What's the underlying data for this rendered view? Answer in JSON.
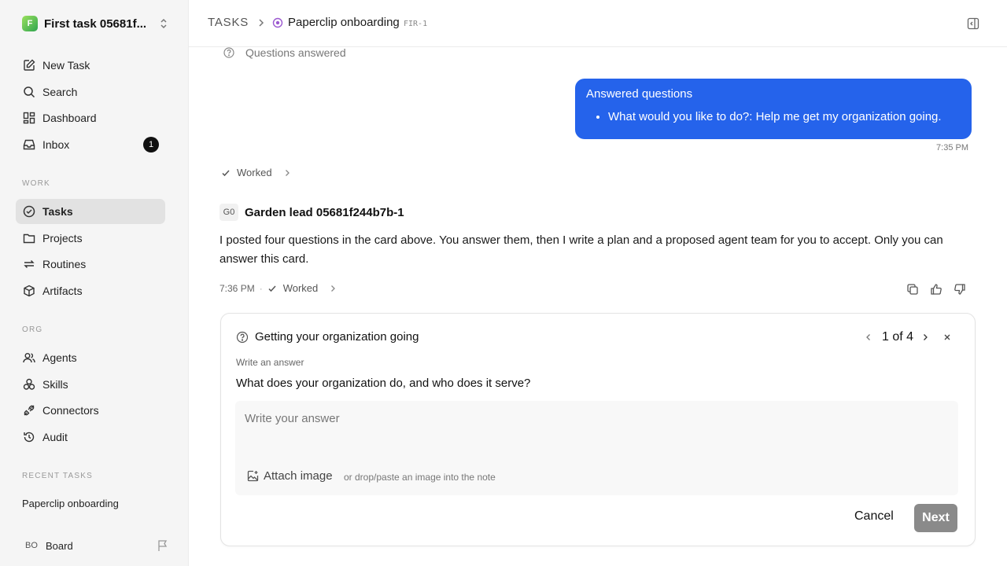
{
  "workspace": {
    "name": "First task 05681f...",
    "logo_letter": "F"
  },
  "nav": {
    "new_task": "New Task",
    "search": "Search",
    "dashboard": "Dashboard",
    "inbox": "Inbox",
    "inbox_count": "1"
  },
  "sections": {
    "work": "WORK",
    "org": "ORG",
    "recent": "RECENT TASKS"
  },
  "work_items": {
    "tasks": "Tasks",
    "projects": "Projects",
    "routines": "Routines",
    "artifacts": "Artifacts"
  },
  "org_items": {
    "agents": "Agents",
    "skills": "Skills",
    "connectors": "Connectors",
    "audit": "Audit"
  },
  "recent_tasks": [
    "Paperclip onboarding"
  ],
  "board": {
    "initials": "BO",
    "name": "Board"
  },
  "header": {
    "root": "TASKS",
    "title": "Paperclip onboarding",
    "id": "FIR-1"
  },
  "thread": {
    "questions_answered": "Questions answered",
    "bubble_title": "Answered questions",
    "bubble_item": "What would you like to do?: Help me get my organization going.",
    "bubble_time": "7:35 PM",
    "worked_label": "Worked",
    "agent_initials": "G0",
    "agent_name": "Garden lead 05681f244b7b-1",
    "agent_message": "I posted four questions in the card above. You answer them, then I write a plan and a proposed agent team for you to accept. Only you can answer this card.",
    "agent_time": "7:36 PM",
    "meta_sep": "·"
  },
  "card": {
    "title": "Getting your organization going",
    "pager": "1 of 4",
    "label": "Write an answer",
    "question": "What does your organization do, and who does it serve?",
    "placeholder": "Write your answer",
    "attach_label": "Attach image",
    "drop_hint": "or drop/paste an image into the note",
    "cancel": "Cancel",
    "next": "Next"
  },
  "colors": {
    "accent": "#2563eb",
    "sidebar_bg": "#f5f5f5",
    "active_item": "#e2e2e2",
    "next_disabled": "#8a8a8a"
  }
}
